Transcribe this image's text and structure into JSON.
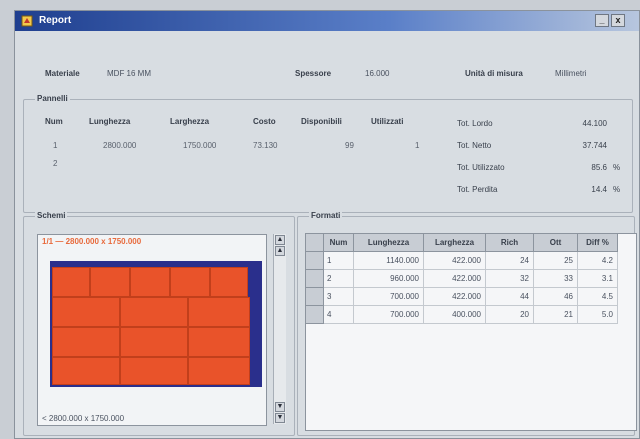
{
  "window": {
    "title": "Report"
  },
  "header": {
    "material": {
      "label": "Materiale",
      "value": "MDF 16 MM"
    },
    "thickness": {
      "label": "Spessore",
      "value": "16.000"
    },
    "units": {
      "label": "Unità di misura",
      "value": "Millimetri"
    }
  },
  "panels": {
    "title": "Pannelli",
    "columns": [
      "Num",
      "Lunghezza",
      "Larghezza",
      "Costo",
      "Disponibili",
      "Utilizzati"
    ],
    "rows": [
      [
        "1",
        "2800.000",
        "1750.000",
        "73.130",
        "99",
        "1"
      ],
      [
        "2",
        "",
        "",
        "",
        "",
        ""
      ]
    ]
  },
  "stats": [
    {
      "label": "Tot. Lordo",
      "value": "44.100",
      "unit": ""
    },
    {
      "label": "Tot. Netto",
      "value": "37.744",
      "unit": ""
    },
    {
      "label": "Tot. Utilizzato",
      "value": "85.6",
      "unit": "%"
    },
    {
      "label": "Tot. Perdita",
      "value": "14.4",
      "unit": "%"
    }
  ],
  "scheme": {
    "title": "Schemi",
    "header_text": "1/1 — 2800.000 x 1750.000",
    "footer_text": "< 2800.000 x 1750.000"
  },
  "pieces": {
    "title": "Formati",
    "columns": [
      "Num",
      "Lunghezza",
      "Larghezza",
      "Rich",
      "Ott",
      "Diff %"
    ],
    "rows": [
      [
        "1",
        "1140.000",
        "422.000",
        "24",
        "25",
        "4.2"
      ],
      [
        "2",
        "960.000",
        "422.000",
        "32",
        "33",
        "3.1"
      ],
      [
        "3",
        "700.000",
        "422.000",
        "44",
        "46",
        "4.5"
      ],
      [
        "4",
        "700.000",
        "400.000",
        "20",
        "21",
        "5.0"
      ]
    ]
  },
  "colors": {
    "panel": "#e9532a",
    "sheet": "#2a2f8c",
    "title_bar": "#1f3f8f"
  }
}
